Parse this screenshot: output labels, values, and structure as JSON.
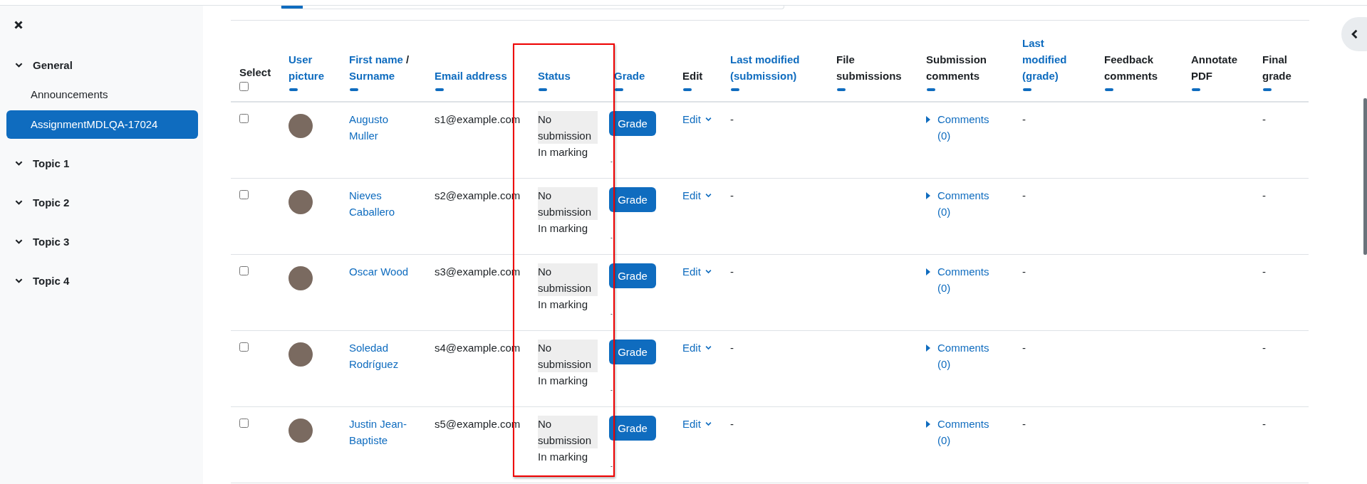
{
  "sidebar": {
    "sections": [
      {
        "label": "General",
        "expanded": true,
        "items": [
          {
            "label": "Announcements",
            "selected": false
          },
          {
            "label": "AssignmentMDLQA-17024",
            "selected": true
          }
        ]
      },
      {
        "label": "Topic 1",
        "expanded": true
      },
      {
        "label": "Topic 2",
        "expanded": true
      },
      {
        "label": "Topic 3",
        "expanded": true
      },
      {
        "label": "Topic 4",
        "expanded": true
      }
    ]
  },
  "table": {
    "columns": [
      {
        "kind": "select",
        "parts": [
          {
            "text": "Select",
            "link": false
          }
        ],
        "sortable": false,
        "checked": false
      },
      {
        "kind": "picture",
        "parts": [
          {
            "text": "User picture",
            "link": true
          }
        ],
        "sortable": true
      },
      {
        "kind": "name",
        "parts": [
          {
            "text": "First name",
            "link": true
          },
          {
            "text": "/",
            "link": false
          },
          {
            "text": "Surname",
            "link": true
          }
        ],
        "sortable": true
      },
      {
        "kind": "email",
        "parts": [
          {
            "text": "Email address",
            "link": true
          }
        ],
        "sortable": true
      },
      {
        "kind": "status",
        "parts": [
          {
            "text": "Status",
            "link": true
          }
        ],
        "sortable": true,
        "highlighted": true
      },
      {
        "kind": "grade",
        "parts": [
          {
            "text": "Grade",
            "link": true
          }
        ],
        "sortable": true
      },
      {
        "kind": "edit",
        "parts": [
          {
            "text": "Edit",
            "link": false
          }
        ],
        "sortable": true
      },
      {
        "kind": "modified",
        "parts": [
          {
            "text": "Last modified (submission)",
            "link": true
          }
        ],
        "sortable": true
      },
      {
        "kind": "files",
        "parts": [
          {
            "text": "File submissions",
            "link": false
          }
        ],
        "sortable": true
      },
      {
        "kind": "comments",
        "parts": [
          {
            "text": "Submission comments",
            "link": false
          }
        ],
        "sortable": true
      },
      {
        "kind": "modified_grade",
        "parts": [
          {
            "text": "Last modified (grade)",
            "link": true
          }
        ],
        "sortable": true
      },
      {
        "kind": "feedback",
        "parts": [
          {
            "text": "Feedback comments",
            "link": false
          }
        ],
        "sortable": true
      },
      {
        "kind": "pdf",
        "parts": [
          {
            "text": "Annotate PDF",
            "link": false
          }
        ],
        "sortable": true
      },
      {
        "kind": "final",
        "parts": [
          {
            "text": "Final grade",
            "link": false
          }
        ],
        "sortable": true
      }
    ],
    "rows": [
      {
        "checked": false,
        "name": "Augusto Muller",
        "email": "s1@example.com",
        "status": "No submission",
        "marking": "In marking",
        "grade_button": "Grade",
        "grade_value": "-",
        "edit": "Edit",
        "last_modified": "-",
        "comments": "Comments (0)",
        "last_modified_grade": "-",
        "final_grade": "-"
      },
      {
        "checked": false,
        "name": "Nieves Caballero",
        "email": "s2@example.com",
        "status": "No submission",
        "marking": "In marking",
        "grade_button": "Grade",
        "grade_value": "-",
        "edit": "Edit",
        "last_modified": "-",
        "comments": "Comments (0)",
        "last_modified_grade": "-",
        "final_grade": "-"
      },
      {
        "checked": false,
        "name": "Oscar Wood",
        "email": "s3@example.com",
        "status": "No submission",
        "marking": "In marking",
        "grade_button": "Grade",
        "grade_value": "-",
        "edit": "Edit",
        "last_modified": "-",
        "comments": "Comments (0)",
        "last_modified_grade": "-",
        "final_grade": "-"
      },
      {
        "checked": false,
        "name": "Soledad Rodríguez",
        "email": "s4@example.com",
        "status": "No submission",
        "marking": "In marking",
        "grade_button": "Grade",
        "grade_value": "-",
        "edit": "Edit",
        "last_modified": "-",
        "comments": "Comments (0)",
        "last_modified_grade": "-",
        "final_grade": "-"
      },
      {
        "checked": false,
        "name": "Justin Jean-Baptiste",
        "email": "s5@example.com",
        "status": "No submission",
        "marking": "In marking",
        "grade_button": "Grade",
        "grade_value": "-",
        "edit": "Edit",
        "last_modified": "-",
        "comments": "Comments (0)",
        "last_modified_grade": "-",
        "final_grade": "-"
      }
    ]
  }
}
